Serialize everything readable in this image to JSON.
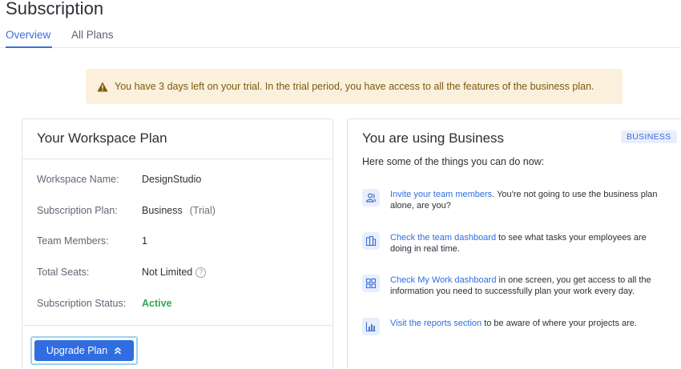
{
  "page": {
    "title": "Subscription"
  },
  "tabs": [
    {
      "label": "Overview",
      "active": true
    },
    {
      "label": "All Plans",
      "active": false
    }
  ],
  "alert": {
    "icon": "warning-icon",
    "text": "You have 3 days left on your trial. In the trial period, you have access to all the features of the business plan."
  },
  "workspace_plan": {
    "title": "Your Workspace Plan",
    "rows": [
      {
        "label": "Workspace Name:",
        "value": "DesignStudio"
      },
      {
        "label": "Subscription Plan:",
        "value": "Business",
        "suffix": "(Trial)"
      },
      {
        "label": "Team Members:",
        "value": "1"
      },
      {
        "label": "Total Seats:",
        "value": "Not Limited",
        "help_icon": "help-icon"
      },
      {
        "label": "Subscription Status:",
        "value": "Active"
      }
    ],
    "upgrade_label": "Upgrade Plan"
  },
  "business": {
    "title": "You are using Business",
    "badge": "BUSINESS",
    "subtitle": "Here some of the things you can do now:",
    "features": [
      {
        "icon": "team-members-icon",
        "link": "Invite your team members",
        "text": ". You're not going to use the business plan alone, are you?"
      },
      {
        "icon": "team-dashboard-icon",
        "link": "Check the team dashboard",
        "text": " to see what tasks your employees are doing in real time."
      },
      {
        "icon": "my-work-dashboard-icon",
        "link": "Check My Work dashboard",
        "text": " in one screen, you get access to all the information you need to successfully plan your work every day."
      },
      {
        "icon": "reports-icon",
        "link": "Visit the reports section",
        "text": " to be aware of where your projects are."
      }
    ]
  },
  "colors": {
    "accent": "#2f6de0",
    "alert_bg": "#fbf0dc",
    "alert_text": "#7c5a10",
    "active_status": "#2fa84f"
  }
}
